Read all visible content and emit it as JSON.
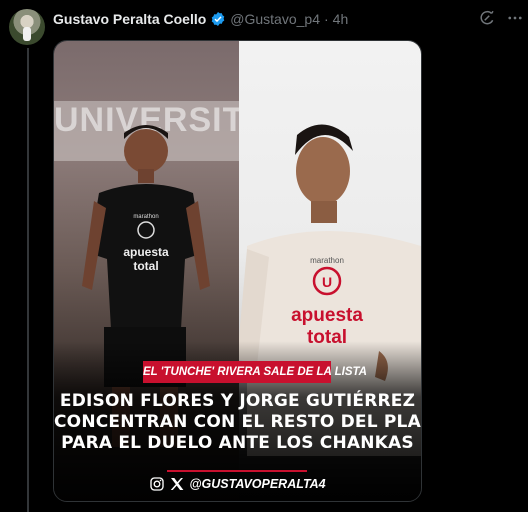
{
  "tweet": {
    "author_name": "Gustavo Peralta Coello",
    "handle": "@Gustavo_p4",
    "separator": "·",
    "time": "4h"
  },
  "media": {
    "left_photo": {
      "banner_text": "UNIVERSITA",
      "shirt_brand": "marathon",
      "shirt_sponsor_line1": "apuesta",
      "shirt_sponsor_line2": "total"
    },
    "right_photo": {
      "shirt_brand": "marathon",
      "shirt_sponsor_line1": "apuesta",
      "shirt_sponsor_line2": "total"
    },
    "tag": "EL 'TUNCHE' RIVERA SALE DE LA LISTA",
    "headline_lines": [
      "EDISON FLORES Y JORGE GUTIÉRREZ",
      "CONCENTRAN CON EL RESTO DEL PLANTEL",
      "PARA EL DUELO ANTE LOS CHANKAS"
    ],
    "social_handle": "@GUSTAVOPERALTA4"
  },
  "colors": {
    "background": "#000000",
    "accent_red": "#c8102e",
    "verified_blue": "#1d9bf0",
    "muted_text": "#71767b"
  },
  "icons": [
    "verified-badge-icon",
    "grok-icon",
    "more-icon",
    "instagram-icon",
    "x-logo-icon"
  ]
}
